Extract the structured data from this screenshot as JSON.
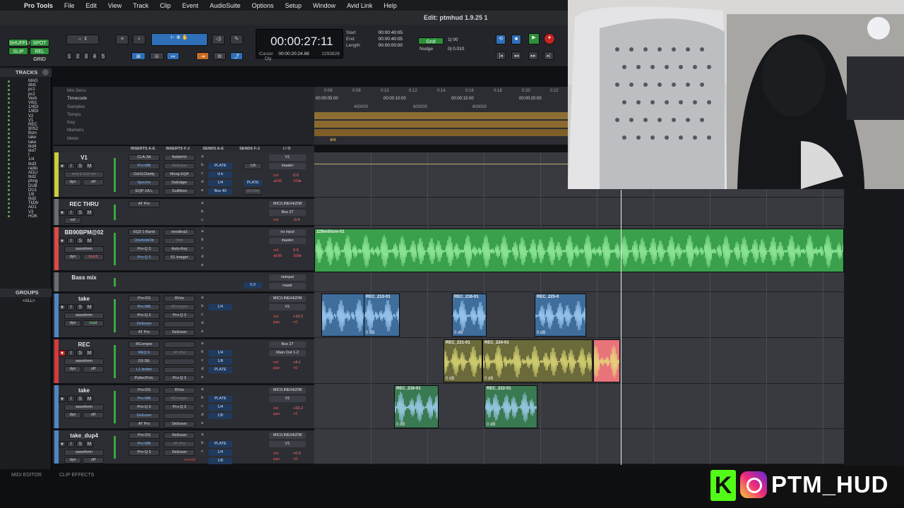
{
  "menubar": {
    "app": "Pro Tools",
    "items": [
      "File",
      "Edit",
      "View",
      "Track",
      "Clip",
      "Event",
      "AudioSuite",
      "Options",
      "Setup",
      "Window",
      "Avid Link",
      "Help"
    ]
  },
  "window": {
    "title": "Edit: ptmhud 1.9.25 1"
  },
  "toolbar": {
    "modes": [
      "SHUFFLE",
      "SPOT",
      "SLIP",
      "REL GRID"
    ],
    "zoom_presets": [
      "1",
      "2",
      "3",
      "4",
      "5"
    ],
    "main_counter": "00:00:27:11",
    "cursor_label": "Cursor",
    "cursor_value": "00:00:20:24.88",
    "sample_value": "2293828",
    "dly_label": "Dly",
    "selection": [
      {
        "label": "Start",
        "value": "00:00:40:05"
      },
      {
        "label": "End",
        "value": "00:00:40:05"
      },
      {
        "label": "Length",
        "value": "00:00:00:00"
      }
    ],
    "grid_label": "Grid",
    "grid_value": "1| 00",
    "nudge_label": "Nudge",
    "nudge_value": "0| 0.010"
  },
  "tracks_panel": {
    "header": "TRACKS",
    "items": [
      "MAG",
      "dbl1",
      "pc1",
      "pc2",
      "Verb",
      "Vrb1",
      "1/4Dl",
      "1/8Dl",
      "V2",
      "V1",
      "REC",
      "90S2",
      "Bsm",
      "take",
      "take",
      "tkd4",
      "tkd7",
      "f",
      "1/4",
      "tkd3",
      "radio",
      "ADLI",
      "tkd2",
      "phng",
      "DUB",
      "DU1",
      "1/8",
      "tkd2",
      "TkDb",
      "AD1",
      "V3",
      "HOK"
    ]
  },
  "groups_panel": {
    "header": "GROUPS",
    "items": [
      "<ALL>"
    ]
  },
  "ruler": {
    "labels": [
      "Min:Secs",
      "Timecode",
      "Samples",
      "Tempo",
      "Key",
      "Markers",
      "Meter"
    ],
    "minsecs": [
      "0:08",
      "0:08",
      "0:10",
      "0:12",
      "0:14",
      "0:16",
      "0:18",
      "0:20",
      "0:22"
    ],
    "timecode": [
      "00:00:05:00",
      "00:00:10:00",
      "00:00:15:00",
      "00:00:20:00"
    ],
    "samples": [
      "400000",
      "600000",
      "800000"
    ],
    "meter_value": "4/4"
  },
  "columns": [
    "INSERTS A-E",
    "INSERTS F-J",
    "SENDS A-E",
    "SENDS F-J",
    "I / O"
  ],
  "tracks": [
    {
      "name": "V1",
      "inserts": [
        "CLA-3A",
        "Pro-MB",
        "Ozt11Clarity",
        "Spectre",
        "EQP-1A L"
      ],
      "inserts2": [
        "NvbbhVi",
        "DeEsser",
        "Mcog EQ4",
        "DeEdger",
        "Guilfiess"
      ],
      "sends": [
        "a",
        "b",
        "c",
        "d",
        "e"
      ],
      "sendvals": [
        "PLATE",
        "d.b",
        "1/4",
        "Bus 40"
      ],
      "io_in": "V1",
      "io_out": "master",
      "vol": "vol",
      "vol_val": "0.0",
      "pan": "◂100",
      "pan_val": "100▸",
      "sublabel": "and & trck trm",
      "auto": "dyn",
      "auto_val": "off",
      "color": "#c9cf3b",
      "extra": "PLATE",
      "room": "ROOM",
      "count": "1/8"
    },
    {
      "name": "REC THRU",
      "inserts": [
        "AT Pro"
      ],
      "sends": [
        "a",
        "b",
        "c",
        "d",
        "e"
      ],
      "io_in": "MIC/LINE/HIZ/M",
      "io_out": "Bus 27",
      "vol": "vol",
      "vol_val": "-0.4",
      "auto": "vol",
      "color": "#6b6d72"
    },
    {
      "name": "BB90BPM@02",
      "inserts": [
        "EQ3 1-Band",
        "OneKnbFltr",
        "Pro-Q 3",
        "Pro-Q 3"
      ],
      "inserts2": [
        "eeodina3",
        "Trim",
        "Auto-Key",
        "S1 Imager"
      ],
      "sends": [
        "a",
        "b",
        "c",
        "d",
        "e"
      ],
      "io_in": "no input",
      "io_out": "master",
      "vol": "vol",
      "vol_val": "0.0",
      "pan": "◂100",
      "pan_val": "100▸",
      "view": "waveform",
      "auto": "dyn",
      "auto_val": "touch",
      "color": "#e04848"
    },
    {
      "name": "Bass mix",
      "extra": "0.0",
      "io_in": "noinput",
      "io_out": "mastr",
      "color": "#6b6d72"
    },
    {
      "name": "take",
      "inserts": [
        "Pro-DS",
        "Pro-MB",
        "Pro-Q 3",
        "DeEsser",
        "AT Pro"
      ],
      "inserts2": [
        "RVox",
        "RCompsr",
        "Pro-Q 3",
        "",
        "DeEsser"
      ],
      "sends": [
        "a",
        "b",
        "c",
        "d",
        "e"
      ],
      "sendvals": [
        "1/4"
      ],
      "io_in": "MIC/LINE/HIZ/M",
      "io_out": "V1",
      "vol": "vol",
      "vol_val": "+10.2",
      "pan": "pan",
      "pan_val": "+0",
      "view": "waveform",
      "auto": "dyn",
      "auto_val": "read",
      "color": "#4e86c8"
    },
    {
      "name": "REC",
      "inserts": [
        "RCompsr",
        "REQ 6",
        "D3 DE",
        "L1 limiter",
        "PultecProL"
      ],
      "inserts2": [
        "",
        "AT Pro",
        "",
        "",
        "Pro-Q 3"
      ],
      "sends": [
        "a",
        "b",
        "c",
        "d",
        "e"
      ],
      "sendvals": [
        "1/4",
        "1/8",
        "PLATE"
      ],
      "io_in": "Bus 27",
      "io_out": "Main Out 1-2",
      "vol": "vol",
      "vol_val": "+4.1",
      "pan": "pan",
      "pan_val": "+0",
      "view": "waveform",
      "auto": "dyn",
      "auto_val": "off",
      "color": "#d63b3b"
    },
    {
      "name": "take",
      "inserts": [
        "Pro-DS",
        "Pro-MB",
        "Pro-Q 3",
        "DeEsser",
        "AT Pro"
      ],
      "inserts2": [
        "RVox",
        "RCompsr",
        "Pro-Q 3",
        "",
        "DeEsser"
      ],
      "sends": [
        "a",
        "b",
        "c",
        "d",
        "e"
      ],
      "sendvals": [
        "PLATE",
        "1/4",
        "1/8"
      ],
      "io_in": "MIC/LINE/HIZ/M",
      "io_out": "V1",
      "vol": "vol",
      "vol_val": "+10.2",
      "pan": "pan",
      "pan_val": "+0",
      "view": "waveform",
      "auto": "dyn",
      "auto_val": "off",
      "color": "#4e86c8"
    },
    {
      "name": "take_dup4",
      "inserts": [
        "Pro-DS",
        "Pro-MB",
        "Pro-Q 3"
      ],
      "inserts2": [
        "DeEsser",
        "AT Pro",
        "DeEsser"
      ],
      "sends": [
        "a",
        "b",
        "c"
      ],
      "sendvals": [
        "PLATE",
        "1/4",
        "1/8"
      ],
      "io_in": "MIC/LINE/HIZ/M",
      "io_out": "V1",
      "vol": "vol",
      "vol_val": "+0.0",
      "pan": "pan",
      "pan_val": "+0",
      "view": "waveform",
      "auto": "dyn",
      "auto_val": "off",
      "color": "#4e86c8",
      "record_label": "record"
    }
  ],
  "clips": [
    {
      "lane": 2,
      "name": "229milliom-01",
      "gain": "",
      "color": "#3aa04c"
    },
    {
      "lane": 4,
      "name": "",
      "gain": "",
      "color": "#3f6e9c"
    },
    {
      "lane": 4,
      "name": "REC_213-01",
      "gain": "0 dB",
      "color": "#3f6e9c"
    },
    {
      "lane": 4,
      "name": "REC_216-01",
      "gain": "0 dB",
      "color": "#3f6e9c"
    },
    {
      "lane": 4,
      "name": "REC_225-0",
      "gain": "0 dB",
      "color": "#3f6e9c"
    },
    {
      "lane": 5,
      "name": "REC_221-01",
      "gain": "0 dB",
      "color": "#6a6a3a"
    },
    {
      "lane": 5,
      "name": "REC_224-01",
      "gain": "0 dB",
      "color": "#6a6a3a"
    },
    {
      "lane": 5,
      "name": "",
      "gain": "",
      "color": "#e8747a"
    },
    {
      "lane": 6,
      "name": "REC_216-01",
      "gain": "0 dB",
      "color": "#3a7a52"
    },
    {
      "lane": 6,
      "name": "REC_222-01",
      "gain": "0 dB",
      "color": "#3a7a52"
    }
  ],
  "bottom": {
    "tabs": [
      "MIDI EDITOR",
      "CLIP EFFECTS"
    ]
  },
  "brand": {
    "k": "K",
    "handle": "PTM_HUD"
  },
  "colors": {
    "accent_blue": "#2f6fb8",
    "record_red": "#c52222",
    "waveform_green": "#3aa04c"
  }
}
